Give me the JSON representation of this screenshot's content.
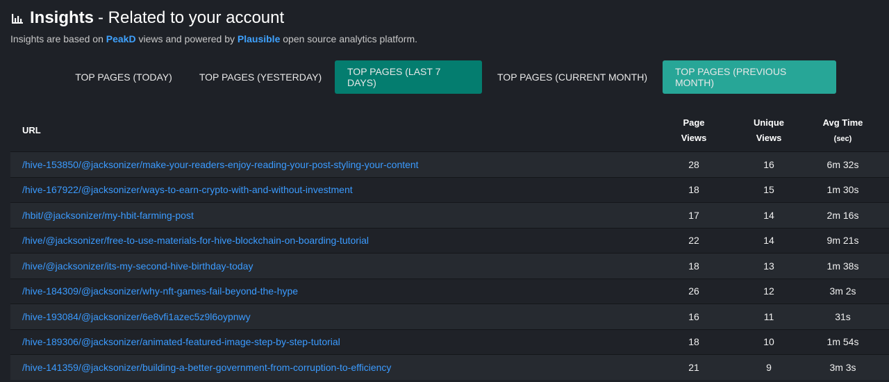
{
  "header": {
    "icon": "bar-chart-icon",
    "title_strong": "Insights",
    "title_rest": "- Related to your account",
    "subtitle_pre": "Insights are based on ",
    "subtitle_link1": "PeakD",
    "subtitle_mid": " views and powered by ",
    "subtitle_link2": "Plausible",
    "subtitle_post": " open source analytics platform."
  },
  "tabs": [
    {
      "label": "TOP PAGES (TODAY)"
    },
    {
      "label": "TOP PAGES (YESTERDAY)"
    },
    {
      "label": "TOP PAGES (LAST 7 DAYS)"
    },
    {
      "label": "TOP PAGES (CURRENT MONTH)"
    },
    {
      "label": "TOP PAGES (PREVIOUS MONTH)"
    }
  ],
  "colors": {
    "active_tab": "#047d6f",
    "highlight_tab": "#27a697",
    "link": "#3b9bff",
    "background": "#1e2127"
  },
  "table": {
    "headers": {
      "url": "URL",
      "page_views_1": "Page",
      "page_views_2": "Views",
      "unique_views_1": "Unique",
      "unique_views_2": "Views",
      "avg_time_1": "Avg Time",
      "avg_time_2": "(sec)"
    },
    "rows": [
      {
        "url": "/hive-153850/@jacksonizer/make-your-readers-enjoy-reading-your-post-styling-your-content",
        "page_views": "28",
        "unique_views": "16",
        "avg_time": "6m 32s"
      },
      {
        "url": "/hive-167922/@jacksonizer/ways-to-earn-crypto-with-and-without-investment",
        "page_views": "18",
        "unique_views": "15",
        "avg_time": "1m 30s"
      },
      {
        "url": "/hbit/@jacksonizer/my-hbit-farming-post",
        "page_views": "17",
        "unique_views": "14",
        "avg_time": "2m 16s"
      },
      {
        "url": "/hive/@jacksonizer/free-to-use-materials-for-hive-blockchain-on-boarding-tutorial",
        "page_views": "22",
        "unique_views": "14",
        "avg_time": "9m 21s"
      },
      {
        "url": "/hive/@jacksonizer/its-my-second-hive-birthday-today",
        "page_views": "18",
        "unique_views": "13",
        "avg_time": "1m 38s"
      },
      {
        "url": "/hive-184309/@jacksonizer/why-nft-games-fail-beyond-the-hype",
        "page_views": "26",
        "unique_views": "12",
        "avg_time": "3m 2s"
      },
      {
        "url": "/hive-193084/@jacksonizer/6e8vfi1azec5z9l6oypnwy",
        "page_views": "16",
        "unique_views": "11",
        "avg_time": "31s"
      },
      {
        "url": "/hive-189306/@jacksonizer/animated-featured-image-step-by-step-tutorial",
        "page_views": "18",
        "unique_views": "10",
        "avg_time": "1m 54s"
      },
      {
        "url": "/hive-141359/@jacksonizer/building-a-better-government-from-corruption-to-efficiency",
        "page_views": "21",
        "unique_views": "9",
        "avg_time": "3m 3s"
      }
    ]
  }
}
